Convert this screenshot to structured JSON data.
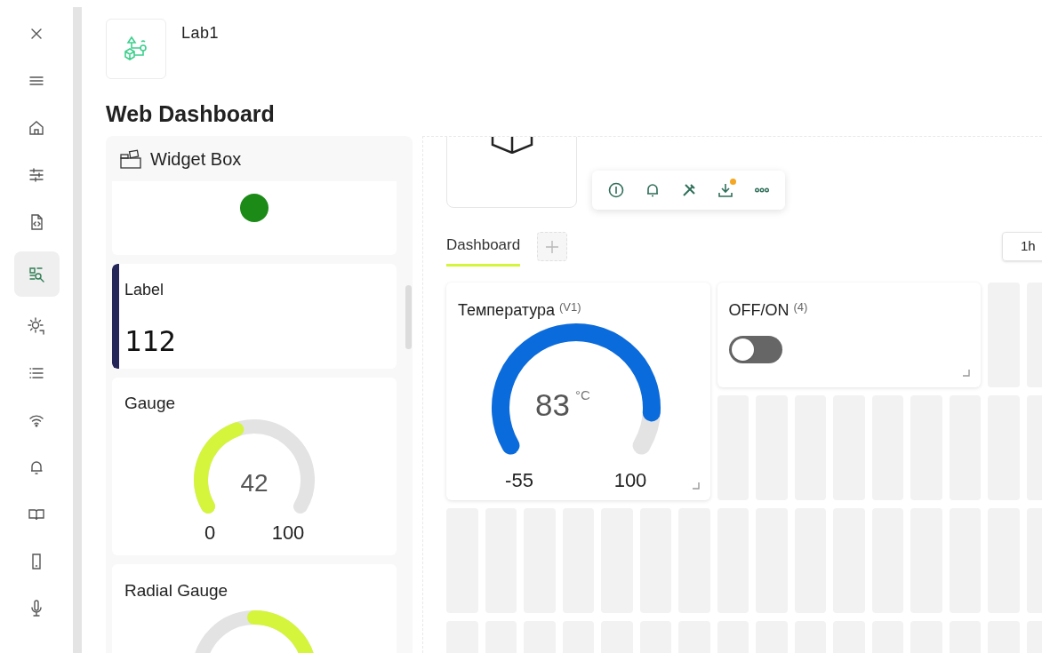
{
  "sidebar": {
    "items": [
      {
        "selected": false
      },
      {
        "selected": false
      },
      {
        "selected": false
      },
      {
        "selected": false
      },
      {
        "selected": false
      },
      {
        "selected": true
      },
      {
        "selected": false
      },
      {
        "selected": false
      },
      {
        "selected": false
      },
      {
        "selected": false
      },
      {
        "selected": false
      },
      {
        "selected": false
      },
      {
        "selected": false
      }
    ]
  },
  "header": {
    "title": "Lab1"
  },
  "page_title": "Web Dashboard",
  "widget_box": {
    "title": "Widget Box",
    "widgets": [
      {
        "kind": "led"
      },
      {
        "kind": "label",
        "title": "Label",
        "value": "112"
      },
      {
        "kind": "gauge",
        "title": "Gauge",
        "value": "42",
        "min": "0",
        "max": "100"
      },
      {
        "kind": "radial_gauge",
        "title": "Radial Gauge"
      }
    ]
  },
  "toolbar": {
    "download_badge": true
  },
  "tabs": [
    {
      "label": "Dashboard",
      "selected": true
    }
  ],
  "time_range": {
    "label": "1h"
  },
  "widgets": [
    {
      "kind": "gauge",
      "title": "Температура",
      "pin": "(V1)",
      "value": "83",
      "unit": "°C",
      "min": "-55",
      "max": "100"
    },
    {
      "kind": "switch",
      "title": "OFF/ON",
      "pin": "(4)",
      "on": false
    }
  ]
}
